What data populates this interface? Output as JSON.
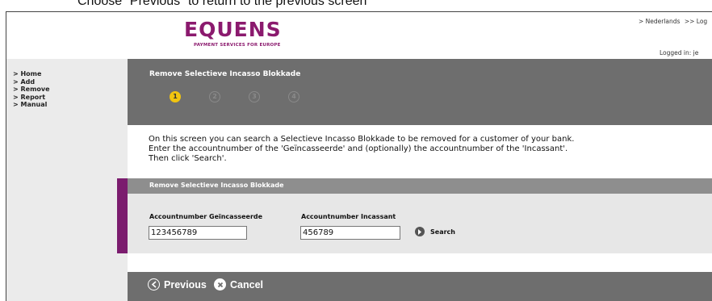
{
  "instruction": "Choose “Previous” to return to the previous screen",
  "brand": {
    "name": "EQUENS",
    "tagline": "PAYMENT SERVICES FOR EUROPE",
    "color": "#8b1a6e"
  },
  "top_links": {
    "language": "> Nederlands",
    "logout": ">> Log"
  },
  "logged_in": "Logged in: je",
  "sidebar": {
    "items": [
      {
        "label": "> Home"
      },
      {
        "label": "> Add"
      },
      {
        "label": "> Remove"
      },
      {
        "label": "> Report"
      },
      {
        "label": "> Manual"
      }
    ]
  },
  "header": {
    "title": "Remove Selectieve Incasso Blokkade",
    "steps": [
      "1",
      "2",
      "3",
      "4"
    ],
    "active_step": 1
  },
  "intro": {
    "line1": "On this screen you can search a Selectieve Incasso Blokkade to be removed for a customer of your bank.",
    "line2": "Enter the accountnumber of the 'Geïncasseerde' and (optionally) the accountnumber of the 'Incassant'.",
    "line3": "Then click 'Search'."
  },
  "panel": {
    "title": "Remove Selectieve Incasso Blokkade",
    "field1_label": "Accountnumber Geïncasseerde",
    "field1_value": "123456789",
    "field2_label": "Accountnumber Incassant",
    "field2_value": "456789",
    "search_label": "Search"
  },
  "footer": {
    "previous_label": "Previous",
    "cancel_label": "Cancel"
  },
  "colors": {
    "accent": "#7b1c6e",
    "header_bg": "#6e6e6e",
    "panel_header_bg": "#8e8e8e",
    "active_step": "#f1c40f"
  }
}
